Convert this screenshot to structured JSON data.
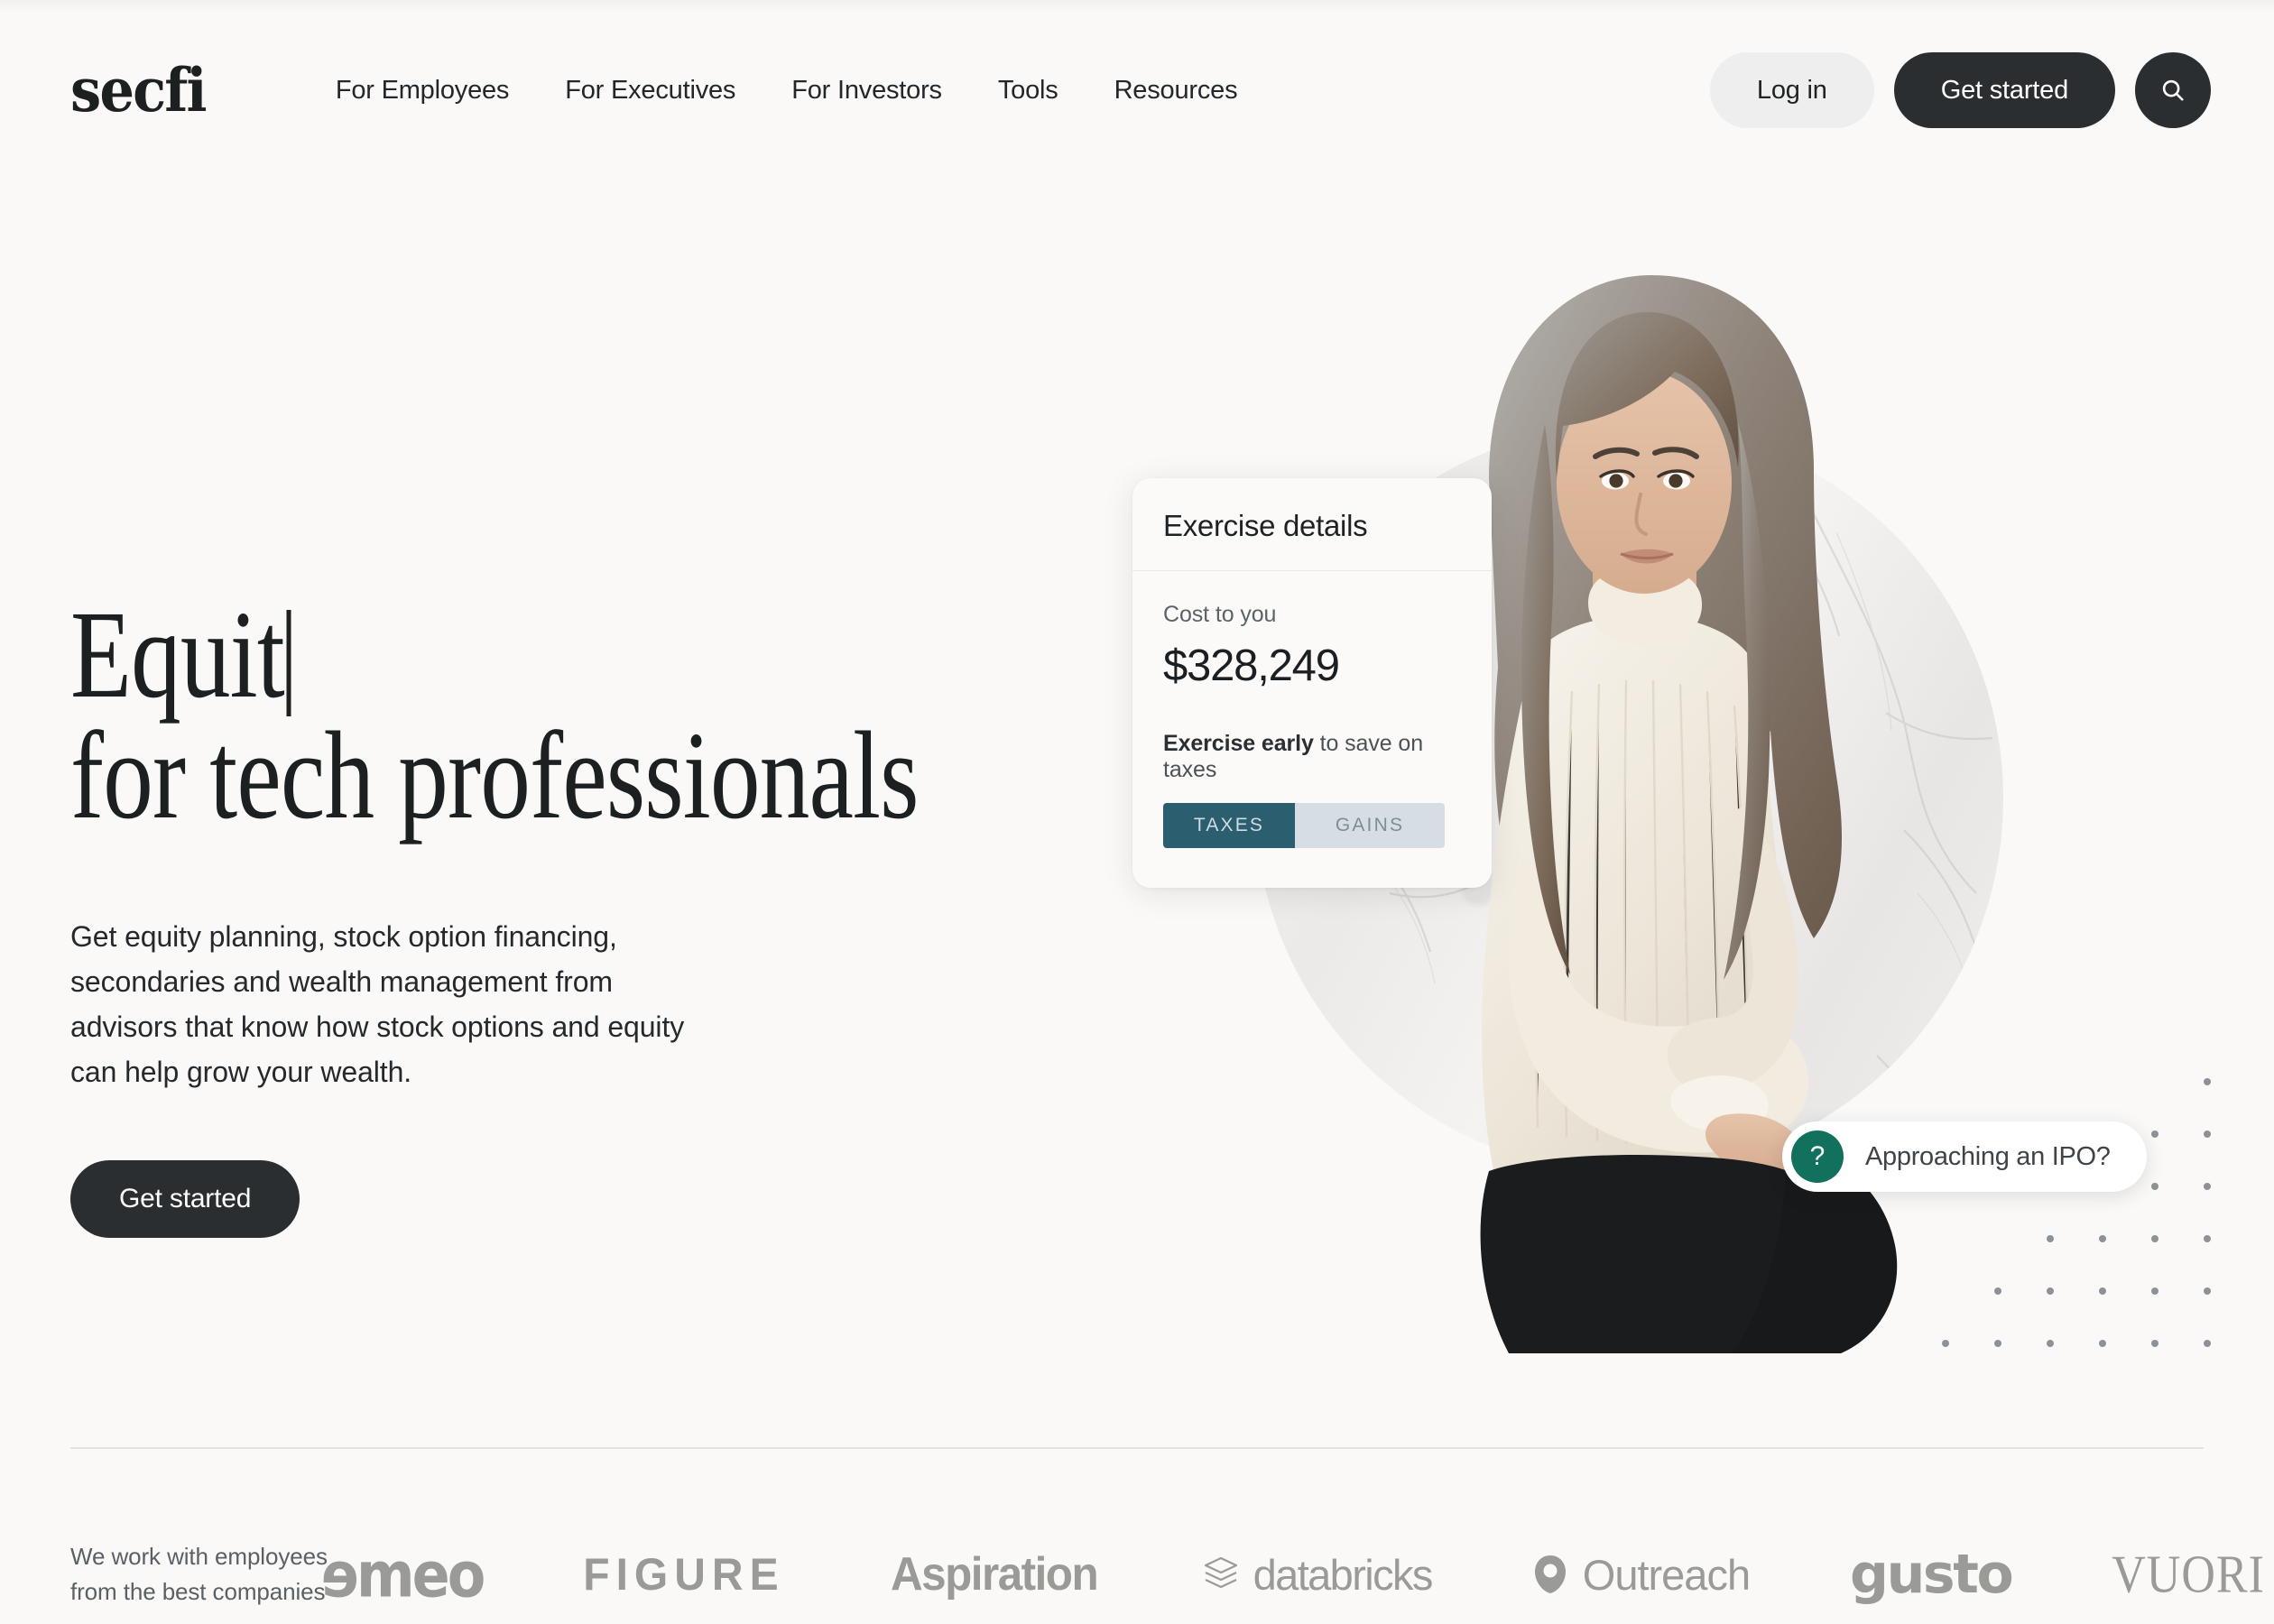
{
  "brand": {
    "logo_text": "secfi"
  },
  "nav": {
    "items": [
      {
        "label": "For Employees"
      },
      {
        "label": "For Executives"
      },
      {
        "label": "For Investors"
      },
      {
        "label": "Tools"
      },
      {
        "label": "Resources"
      }
    ],
    "login_label": "Log in",
    "get_started_label": "Get started",
    "search_icon": "search-icon"
  },
  "hero": {
    "title_line1": "Equit",
    "title_line2": "for tech professionals",
    "typing_caret": true,
    "subtitle": "Get equity planning, stock option financing, secondaries and wealth management from advisors that know how stock options and equity can help grow your wealth.",
    "cta_label": "Get started"
  },
  "card": {
    "title": "Exercise details",
    "cost_label": "Cost to you",
    "cost_value": "$328,249",
    "note_bold": "Exercise early",
    "note_rest": " to save on taxes",
    "segments": [
      {
        "label": "TAXES",
        "color": "#2b5e6e"
      },
      {
        "label": "GAINS",
        "color": "#d6dee3"
      }
    ]
  },
  "chip": {
    "badge_glyph": "?",
    "badge_icon": "question-mark-icon",
    "text": "Approaching an IPO?",
    "badge_color": "#12715c"
  },
  "logo_strip": {
    "label_line1": "We work with employees",
    "label_line2": "from the best companies",
    "logos": [
      {
        "name": "ameo",
        "text": "ɘmeo"
      },
      {
        "name": "figure",
        "text": "FIGURE"
      },
      {
        "name": "aspiration",
        "text": "Aspiration"
      },
      {
        "name": "databricks",
        "text": "databricks"
      },
      {
        "name": "outreach",
        "text": "Outreach"
      },
      {
        "name": "gusto",
        "text": "gusto"
      },
      {
        "name": "vuori",
        "text": "VUORI"
      }
    ]
  },
  "colors": {
    "background": "#faf9f7",
    "dark_button": "#2b2e30",
    "light_button": "#eeeeee",
    "teal": "#2b5e6e",
    "teal_light": "#d6dee3",
    "green": "#12715c",
    "logo_gray": "#9a9a97"
  }
}
